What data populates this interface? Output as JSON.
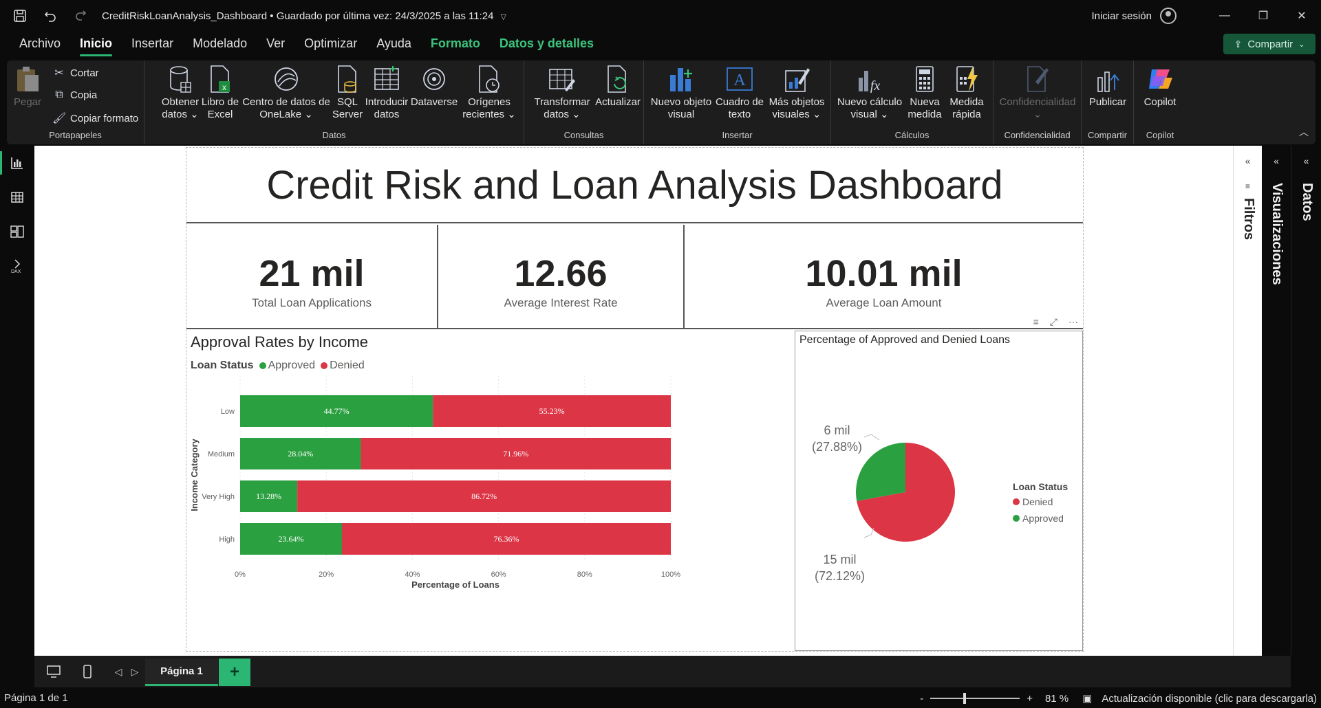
{
  "titlebar": {
    "title": "CreditRiskLoanAnalysis_Dashboard • Guardado por última vez: 24/3/2025 a las 11:24",
    "signin": "Iniciar sesión"
  },
  "menu": {
    "tabs": [
      "Archivo",
      "Inicio",
      "Insertar",
      "Modelado",
      "Ver",
      "Optimizar",
      "Ayuda",
      "Formato",
      "Datos y detalles"
    ],
    "share": "Compartir"
  },
  "ribbon": {
    "clipboard": {
      "paste": "Pegar",
      "cut": "Cortar",
      "copy": "Copia",
      "format_painter": "Copiar formato",
      "label": "Portapapeles"
    },
    "data": {
      "get_data": "Obtener datos ⌄",
      "excel": "Libro de Excel",
      "onelake": "Centro de datos de OneLake ⌄",
      "sql": "SQL Server",
      "enter": "Introducir datos",
      "dataverse": "Dataverse",
      "recent": "Orígenes recientes ⌄",
      "label": "Datos"
    },
    "queries": {
      "transform": "Transformar datos ⌄",
      "refresh": "Actualizar",
      "label": "Consultas"
    },
    "insert": {
      "new_visual": "Nuevo objeto visual",
      "textbox": "Cuadro de texto",
      "more_visuals": "Más objetos visuales ⌄",
      "label": "Insertar"
    },
    "calc": {
      "new_calc": "Nuevo cálculo visual ⌄",
      "new_measure": "Nueva medida",
      "quick_measure": "Medida rápida",
      "label": "Cálculos"
    },
    "sensitivity": {
      "button": "Confidencialidad ⌄",
      "label": "Confidencialidad"
    },
    "share": {
      "publish": "Publicar",
      "label": "Compartir"
    },
    "copilot": {
      "button": "Copilot",
      "label": "Copilot"
    }
  },
  "report": {
    "title": "Credit Risk and Loan Analysis Dashboard",
    "kpis": [
      {
        "value": "21 mil",
        "label": "Total Loan Applications"
      },
      {
        "value": "12.66",
        "label": "Average Interest Rate"
      },
      {
        "value": "10.01 mil",
        "label": "Average Loan Amount"
      }
    ]
  },
  "chart_data": [
    {
      "type": "bar",
      "stacked": "100%",
      "orientation": "horizontal",
      "title": "Approval Rates by Income",
      "legend_title": "Loan Status",
      "legend_position": "top-left",
      "categories": [
        "Low",
        "Medium",
        "Very High",
        "High"
      ],
      "series": [
        {
          "name": "Approved",
          "color": "#2aa040",
          "values": [
            44.77,
            28.04,
            13.28,
            23.64
          ],
          "labels": [
            "44.77%",
            "28.04%",
            "13.28%",
            "23.64%"
          ]
        },
        {
          "name": "Denied",
          "color": "#dc3545",
          "values": [
            55.23,
            71.96,
            86.72,
            76.36
          ],
          "labels": [
            "55.23%",
            "71.96%",
            "86.72%",
            "76.36%"
          ]
        }
      ],
      "xlabel": "Percentage of Loans",
      "ylabel": "Income Category",
      "xlim": [
        0,
        100
      ],
      "xticks": [
        "0%",
        "20%",
        "40%",
        "60%",
        "80%",
        "100%"
      ]
    },
    {
      "type": "pie",
      "title": "Percentage of Approved and Denied Loans",
      "legend_title": "Loan Status",
      "legend_position": "right",
      "slices": [
        {
          "name": "Denied",
          "value": 72.12,
          "color": "#dc3545",
          "label_value": "15 mil",
          "label_pct": "(72.12%)"
        },
        {
          "name": "Approved",
          "value": 27.88,
          "color": "#2aa040",
          "label_value": "6 mil",
          "label_pct": "(27.88%)"
        }
      ]
    }
  ],
  "pagebar": {
    "page_tab": "Página 1",
    "add": "+"
  },
  "panes": {
    "filters": "Filtros",
    "visualizations": "Visualizaciones",
    "data": "Datos"
  },
  "status": {
    "page": "Página 1 de 1",
    "zoom": "81 %",
    "update": "Actualización disponible (clic para descargarla)"
  }
}
